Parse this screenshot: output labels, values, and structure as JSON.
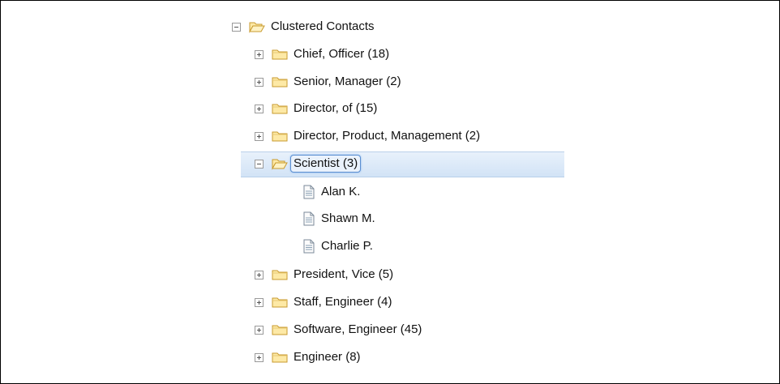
{
  "tree": {
    "root": {
      "label": "Clustered Contacts",
      "expanded": true
    },
    "folders": [
      {
        "label": "Chief, Officer (18)"
      },
      {
        "label": "Senior, Manager (2)"
      },
      {
        "label": "Director, of (15)"
      },
      {
        "label": "Director, Product, Management (2)"
      },
      {
        "label": "Scientist (3)",
        "expanded": true,
        "selected": true,
        "children": [
          {
            "label": "Alan K."
          },
          {
            "label": "Shawn M."
          },
          {
            "label": "Charlie P."
          }
        ]
      },
      {
        "label": "President, Vice (5)"
      },
      {
        "label": "Staff, Engineer (4)"
      },
      {
        "label": "Software, Engineer (45)"
      },
      {
        "label": "Engineer (8)"
      }
    ]
  },
  "icons": {
    "folder_closed": "folder-icon",
    "folder_open": "folder-open-icon",
    "document": "document-icon",
    "expand": "expand-toggle",
    "collapse": "collapse-toggle"
  },
  "colors": {
    "folder_fill": "#fde9a6",
    "folder_stroke": "#c89a2e",
    "selection": "#d2e3f6",
    "selection_border": "#5b8fd1"
  }
}
